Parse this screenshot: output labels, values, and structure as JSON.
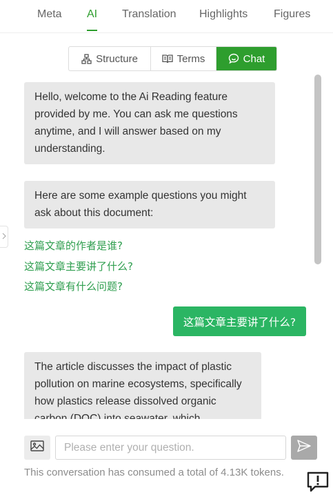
{
  "tabs": [
    {
      "label": "Meta",
      "active": false
    },
    {
      "label": "AI",
      "active": true
    },
    {
      "label": "Translation",
      "active": false
    },
    {
      "label": "Highlights",
      "active": false
    },
    {
      "label": "Figures",
      "active": false
    }
  ],
  "segments": {
    "structure": {
      "label": "Structure",
      "icon": "structure-icon"
    },
    "terms": {
      "label": "Terms",
      "icon": "book-icon"
    },
    "chat": {
      "label": "Chat",
      "icon": "chat-bubble-icon",
      "active": true
    }
  },
  "chat": {
    "welcome": "Hello, welcome to the Ai Reading feature provided by me. You can ask me questions anytime, and I will answer based on my understanding.",
    "examples_intro": "Here are some example questions you might ask about this document:",
    "suggested_questions": [
      "这篇文章的作者是谁?",
      "这篇文章主要讲了什么?",
      "这篇文章有什么问题?"
    ],
    "user_message": "这篇文章主要讲了什么?",
    "answer": "The article discusses the impact of plastic pollution on marine ecosystems, specifically how plastics release dissolved organic carbon (DOC) into seawater, which"
  },
  "composer": {
    "placeholder": "Please enter your question.",
    "value": "",
    "image_icon": "image-icon",
    "send_icon": "send-icon"
  },
  "tokens_text": "This conversation has consumed a total of 4.13K tokens.",
  "feedback_icon": "feedback-icon",
  "colors": {
    "accent": "#2e9e2e",
    "user_bubble": "#2bb563",
    "link": "#2e9e4e",
    "ai_bubble": "#e8e8e8"
  }
}
